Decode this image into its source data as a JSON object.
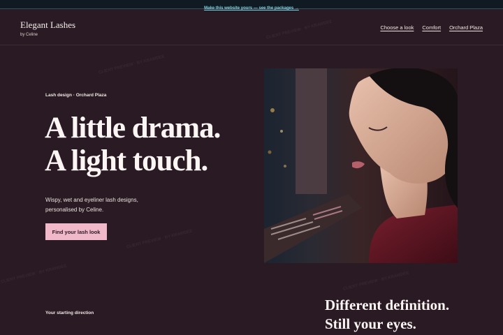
{
  "banner": {
    "link_label": "Make this website yours — see the packages →"
  },
  "brand": {
    "name": "Elegant Lashes",
    "byline": "by Celine"
  },
  "nav": {
    "items": [
      {
        "label": "Choose a look"
      },
      {
        "label": "Comfort"
      },
      {
        "label": "Orchard Plaza"
      }
    ]
  },
  "hero": {
    "eyebrow": "Lash design · Orchard Plaza",
    "title_line1": "A little drama.",
    "title_line2": "A light touch.",
    "lede": "Wispy, wet and eyeliner lash designs, personalised by Celine.",
    "cta_label": "Find your lash look"
  },
  "next": {
    "label": "Your starting direction",
    "title_line1": "Different definition.",
    "title_line2": "Still your eyes."
  },
  "watermark": {
    "text": "CLIENT PREVIEW · BY KRAWDEE"
  },
  "colors": {
    "background": "#2a1a23",
    "accent": "#f0b8c8",
    "banner_link": "#7fd8e8"
  }
}
